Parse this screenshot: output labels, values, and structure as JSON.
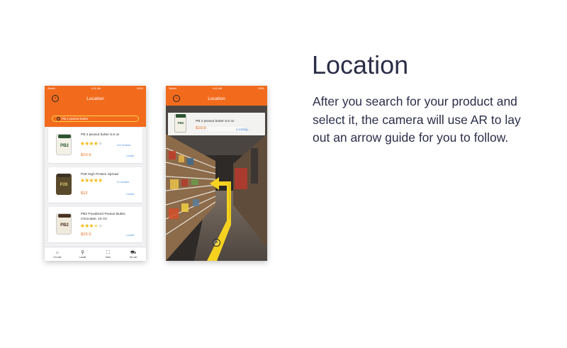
{
  "heading": "Location",
  "description": "After you search for your product and select it, the camera will use AR to lay out an arrow guide for you to follow.",
  "colors": {
    "accent": "#f26b1d",
    "search_outline": "#ffd04a",
    "star": "#f7b500",
    "link": "#4a90d9",
    "arrow": "#f5d21f"
  },
  "search_screen": {
    "status": {
      "carrier": "Sketch",
      "time": "9:41 AM",
      "battery": "100%"
    },
    "nav_title": "Location",
    "back_icon": "chevron-left-circle-icon",
    "search_value": "PB 2 peanut butter",
    "products": [
      {
        "name": "PB 2 peanut butter 6.5 oz",
        "rating": 4,
        "reviews": "312 reviews",
        "price": "$10.9",
        "action": "Locate",
        "thumb_text": "PB2"
      },
      {
        "name": "P28 High Protein Spread",
        "rating": 5,
        "reviews": "21 reviews",
        "price": "$12",
        "action": "Locate",
        "thumb_text": "P28"
      },
      {
        "name": "PB2 Powdered Peanut Butter, Chocolate, 16 Oz",
        "rating": 3.5,
        "reviews": "",
        "price": "$15.9",
        "action": "Locate",
        "thumb_text": "PB2"
      }
    ],
    "tabs": [
      {
        "label": "On sale",
        "icon": "tag-icon"
      },
      {
        "label": "Locate",
        "icon": "search-icon"
      },
      {
        "label": "Scan",
        "icon": "scan-icon"
      },
      {
        "label": "My cart",
        "icon": "cart-icon"
      }
    ]
  },
  "ar_screen": {
    "status": {
      "carrier": "Sketch",
      "time": "9:41 AM",
      "battery": "100%"
    },
    "nav_title": "Location",
    "product_name": "PB 2 peanut butter 6.5 oz",
    "price": "$10.9",
    "status_text": "Locating...",
    "jar_text": "PB2",
    "close_icon": "close-circle-icon"
  }
}
